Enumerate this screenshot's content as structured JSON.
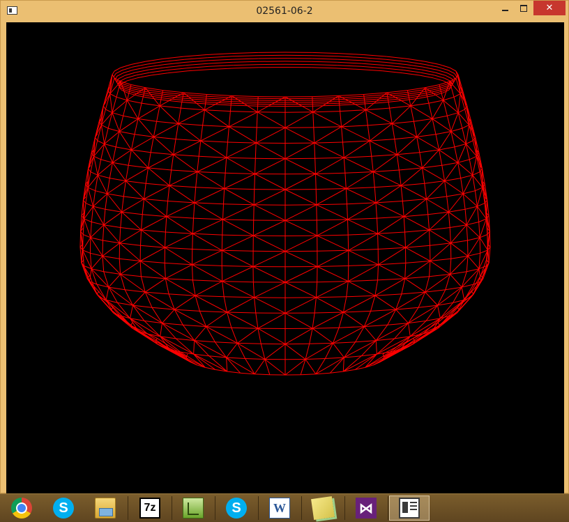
{
  "window": {
    "title": "02561-06-2",
    "icon": "app-window-icon",
    "controls": {
      "minimize": "minimize-icon",
      "maximize": "maximize-icon",
      "close": "✕"
    }
  },
  "viewport": {
    "background": "#000000",
    "mesh_color": "#ff0000",
    "content": "red wireframe mesh of a rounded pot/bowl shape"
  },
  "taskbar": {
    "items": [
      {
        "name": "chrome",
        "icon": "chrome-icon",
        "glyph": ""
      },
      {
        "name": "skype",
        "icon": "skype-icon",
        "glyph": "S"
      },
      {
        "name": "file-explorer",
        "icon": "file-explorer-icon",
        "glyph": ""
      },
      {
        "name": "7zip",
        "icon": "7zip-icon",
        "glyph": "7z"
      },
      {
        "name": "notepad-plus",
        "icon": "notepad-icon",
        "glyph": ""
      },
      {
        "name": "skype-2",
        "icon": "skype-icon",
        "glyph": "S"
      },
      {
        "name": "word",
        "icon": "word-icon",
        "glyph": "W"
      },
      {
        "name": "sticky-notes",
        "icon": "sticky-notes-icon",
        "glyph": ""
      },
      {
        "name": "visual-studio",
        "icon": "visual-studio-icon",
        "glyph": "⋈"
      },
      {
        "name": "active-window",
        "icon": "app-window-icon",
        "glyph": "",
        "active": true
      }
    ]
  }
}
